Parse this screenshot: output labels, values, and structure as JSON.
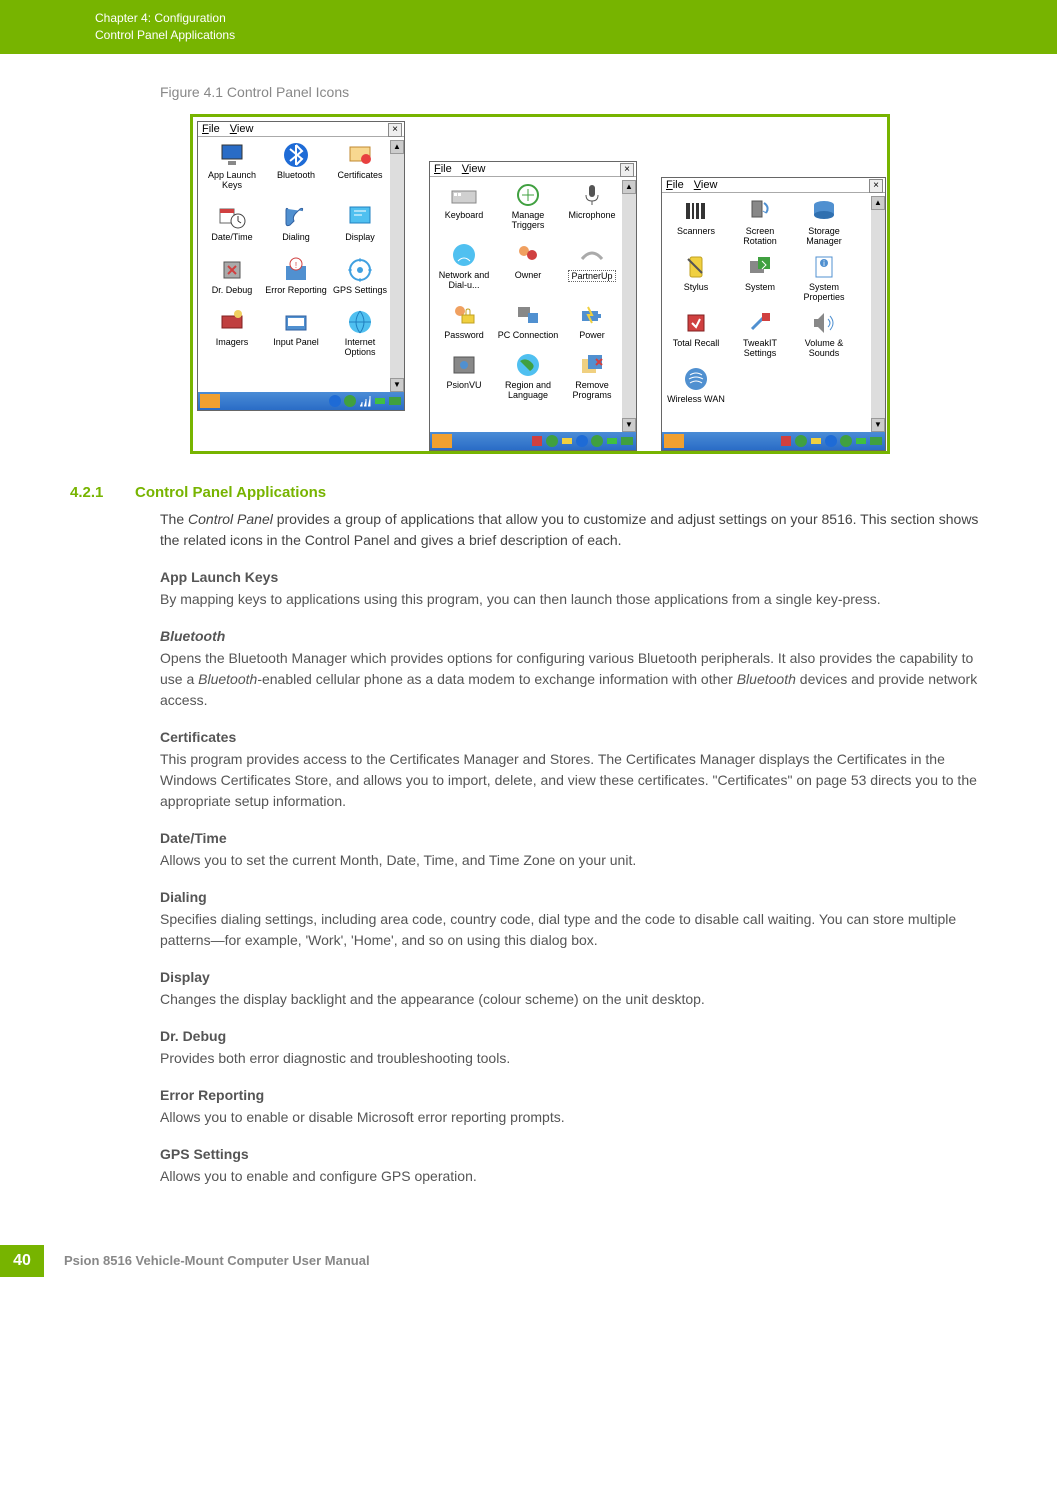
{
  "header": {
    "chapter": "Chapter 4:  Configuration",
    "section": "Control Panel Applications"
  },
  "figure": {
    "caption": "Figure 4.1     Control Panel Icons",
    "menu_file": "File",
    "menu_view": "View",
    "close": "×",
    "panel1_items": [
      "App Launch Keys",
      "Bluetooth",
      "Certificates",
      "Date/Time",
      "Dialing",
      "Display",
      "Dr. Debug",
      "Error Reporting",
      "GPS Settings",
      "Imagers",
      "Input Panel",
      "Internet Options"
    ],
    "panel2_items": [
      "Keyboard",
      "Manage Triggers",
      "Microphone",
      "Network and Dial-u...",
      "Owner",
      "PartnerUp",
      "Password",
      "PC Connection",
      "Power",
      "PsionVU",
      "Region and Language",
      "Remove Programs"
    ],
    "panel3_items": [
      "Scanners",
      "Screen Rotation",
      "Storage Manager",
      "Stylus",
      "System",
      "System Properties",
      "Total Recall",
      "TweakIT Settings",
      "Volume & Sounds",
      "Wireless WAN"
    ]
  },
  "section": {
    "number": "4.2.1",
    "title": "Control Panel Applications",
    "intro_p1": "The ",
    "intro_italic": "Control Panel",
    "intro_p2": " provides a group of applications that allow you to customize and adjust settings on your 8516. This section shows the related icons in the Control Panel and gives a brief description of each."
  },
  "items": [
    {
      "heading": "App Launch Keys",
      "body": "By mapping keys to applications using this program, you can then launch those applications from a single key-press."
    },
    {
      "heading": "Bluetooth",
      "body_parts": [
        "Opens the Bluetooth Manager which provides options for configuring various Bluetooth peripherals. It also provides the capability to use a ",
        {
          "i": "Bluetooth"
        },
        "-enabled cellular phone as a data modem to exchange information with other ",
        {
          "i": "Bluetooth"
        },
        " devices and provide network access."
      ]
    },
    {
      "heading": "Certificates",
      "body": "This program provides access to the Certificates Manager and Stores. The Certificates Manager displays the Certificates in the Windows Certificates Store, and allows you to import, delete, and view these certificates. \"Certificates\" on page 53 directs you to the appropriate setup information."
    },
    {
      "heading": "Date/Time",
      "body": "Allows you to set the current Month, Date, Time, and Time Zone on your unit."
    },
    {
      "heading": "Dialing",
      "body": "Specifies dialing settings, including area code, country code, dial type and the code to disable call waiting. You can store multiple patterns—for example, 'Work', 'Home', and so on using this dialog box."
    },
    {
      "heading": "Display",
      "body": "Changes the display backlight and the appearance (colour scheme) on the unit desktop."
    },
    {
      "heading": "Dr. Debug",
      "body": "Provides both error diagnostic and troubleshooting tools."
    },
    {
      "heading": "Error Reporting",
      "body": "Allows you to enable or disable Microsoft error reporting prompts."
    },
    {
      "heading": "GPS Settings",
      "body": "Allows you to enable and configure GPS operation."
    }
  ],
  "footer": {
    "page": "40",
    "text": "Psion 8516 Vehicle-Mount Computer User Manual"
  }
}
